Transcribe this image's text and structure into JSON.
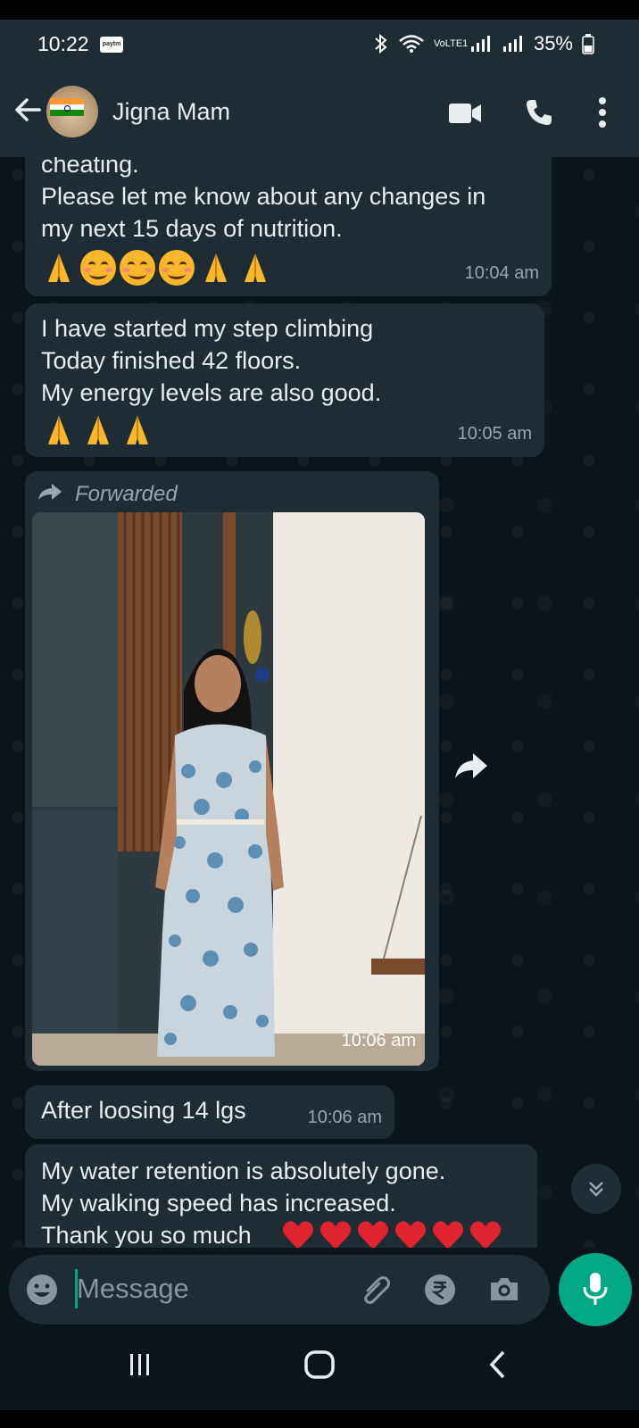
{
  "status_bar": {
    "time": "10:22",
    "paytm_label": "paytm",
    "network_label": "VoLTE1",
    "battery": "35%"
  },
  "header": {
    "contact_name": "Jigna Mam",
    "icons": [
      "back-arrow-icon",
      "video-call-icon",
      "voice-call-icon",
      "more-options-icon"
    ]
  },
  "messages": [
    {
      "text": "cheating.\nPlease let me know about any changes in\nmy next 15 days of  nutrition.",
      "emojis": [
        "folded-hands",
        "smiling-face",
        "smiling-face",
        "smiling-face",
        "folded-hands",
        "folded-hands"
      ],
      "time": "10:04 am"
    },
    {
      "text": "I have started my step climbing\nToday finished 42 floors.\nMy energy levels are also good.",
      "emojis": [
        "folded-hands",
        "folded-hands",
        "folded-hands"
      ],
      "time": "10:05 am"
    },
    {
      "forwarded_label": "Forwarded",
      "type": "image",
      "image_description_icon": "photo",
      "time": "10:06 am"
    },
    {
      "text": "After loosing 14 lgs",
      "time": "10:06 am"
    },
    {
      "text": "My water retention is absolutely gone.\nMy walking speed has increased.\nThank you so much",
      "emojis": [
        "red-heart",
        "red-heart",
        "red-heart",
        "red-heart",
        "red-heart",
        "red-heart"
      ]
    }
  ],
  "composer": {
    "placeholder": "Message",
    "icons": [
      "emoji-icon",
      "attach-icon",
      "rupee-payment-icon",
      "camera-icon",
      "mic-icon"
    ]
  },
  "colors": {
    "app_bar": "#1f2c34",
    "background": "#0b141a",
    "bubble": "#1f2c34",
    "accent": "#00a884",
    "meta_text": "#9aa6ad"
  }
}
